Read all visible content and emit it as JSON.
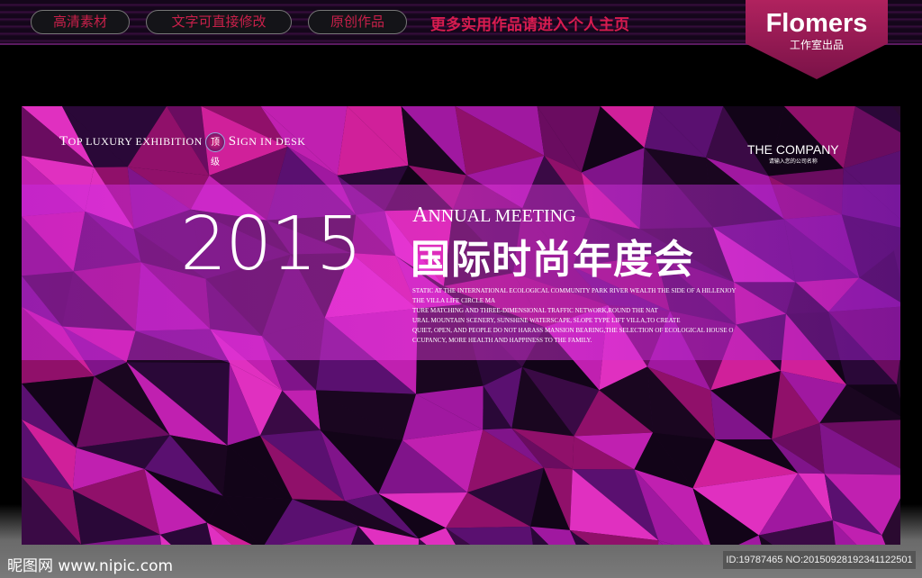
{
  "topbar": {
    "pills": [
      "高清素材",
      "文字可直接修改",
      "原创作品"
    ],
    "promo": "更多实用作品请进入个人主页",
    "logo": {
      "brand": "Flomers",
      "sub": "工作室出品"
    }
  },
  "banner": {
    "tagline_left": {
      "a": "T",
      "b": "OP LUXURY EXHIBITION",
      "badge": "顶级",
      "c": "S",
      "d": "IGN IN DESK"
    },
    "company": {
      "name": "THE COMPANY",
      "sub": "请输入您的公司名称"
    },
    "year": "2015",
    "annual": {
      "a": "A",
      "b": "NNUAL MEETING"
    },
    "title_cn": "国际时尚年度会",
    "paragraph": [
      "STATIC AT THE INTERNATIONAL ECOLOGICAL COMMUNITY PARK RIVER WEALTH THE SIDE OF A HILLENJOY",
      "THE VILLA LIFE CIRCLE MA",
      "TURE MATCHING AND THREE-DIMENSIONAL TRAFFIC NETWORK,ROUND THE NAT",
      "URAL MOUNTAIN SCENERY, SUNSHINE WATERSCAPE, SLOPE TYPE LIFT VILLA,TO CREATE",
      "QUIET, OPEN, AND PEOPLE DO NOT HARASS MANSION BEARING,THE SELECTION OF ECOLOGICAL HOUSE O",
      "CCUPANCY, MORE HEALTH AND HAPPINESS TO THE FAMILY."
    ]
  },
  "footer": {
    "watermark": "昵图网 www.nipic.com",
    "id": "ID:19787465 NO:20150928192341122501"
  }
}
